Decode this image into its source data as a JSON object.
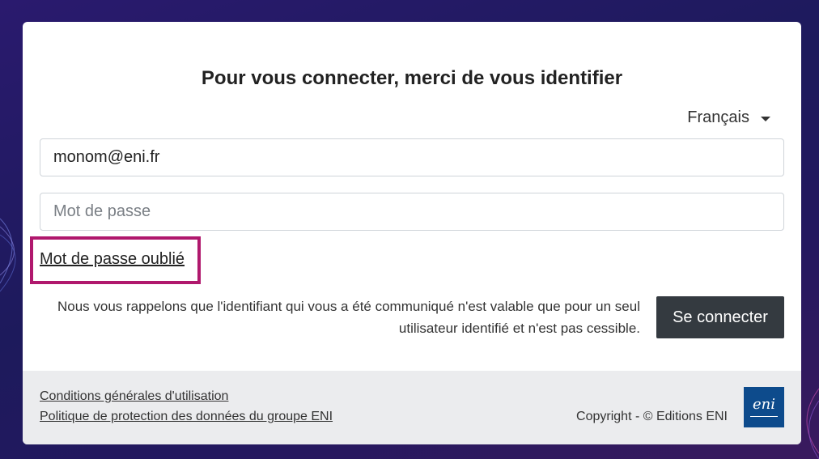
{
  "page": {
    "title": "Pour vous connecter, merci de vous identifier"
  },
  "language": {
    "selected": "Français"
  },
  "form": {
    "email_value": "monom@eni.fr",
    "password_placeholder": "Mot de passe",
    "forgot_password_label": "Mot de passe oublié",
    "notice_line1": "Nous vous rappelons que l'identifiant qui vous a été communiqué n'est valable que pour un seul",
    "notice_line2": "utilisateur identifié et n'est pas cessible.",
    "submit_label": "Se connecter"
  },
  "footer": {
    "terms_label": "Conditions générales d'utilisation",
    "privacy_label": "Politique de protection des données du groupe ENI",
    "copyright": "Copyright - © Editions ENI",
    "logo_text": "eni"
  },
  "colors": {
    "highlight_border": "#b0186d",
    "button_bg": "#343a40",
    "logo_bg": "#0d4b8c",
    "footer_bg": "#ebecee"
  }
}
